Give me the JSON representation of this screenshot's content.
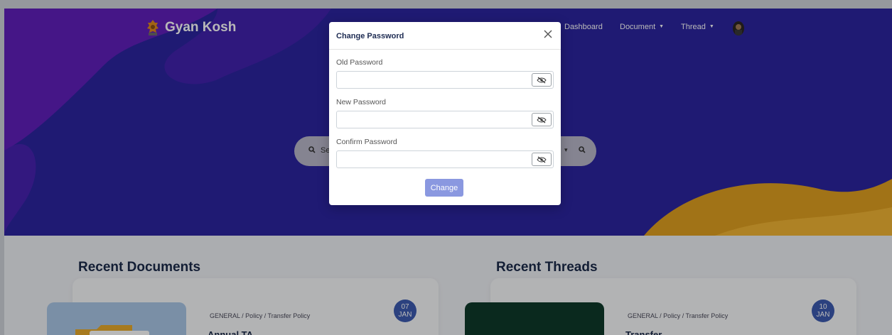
{
  "app": {
    "brand": "Gyan Kosh"
  },
  "nav": {
    "dashboard": "Dashboard",
    "document": "Document",
    "thread": "Thread"
  },
  "search": {
    "placeholder_fragment": "Se"
  },
  "sections": {
    "recent_documents": "Recent Documents",
    "recent_threads": "Recent Threads"
  },
  "documents": [
    {
      "breadcrumb": "GENERAL / Policy / Transfer Policy",
      "date_day": "07",
      "date_month": "JAN",
      "title": "Annual TA..."
    }
  ],
  "threads": [
    {
      "breadcrumb": "GENERAL / Policy / Transfer Policy",
      "date_day": "10",
      "date_month": "JAN",
      "title": "Transfer..."
    }
  ],
  "modal": {
    "title": "Change Password",
    "old_password_label": "Old Password",
    "new_password_label": "New Password",
    "confirm_password_label": "Confirm Password",
    "submit_label": "Change"
  },
  "colors": {
    "hero_bg": "#2c24a0",
    "accent_orange": "#f5a623",
    "accent_purple": "#7a1fc4",
    "button_primary": "#8a98e0",
    "date_badge": "#3c5ab0"
  }
}
